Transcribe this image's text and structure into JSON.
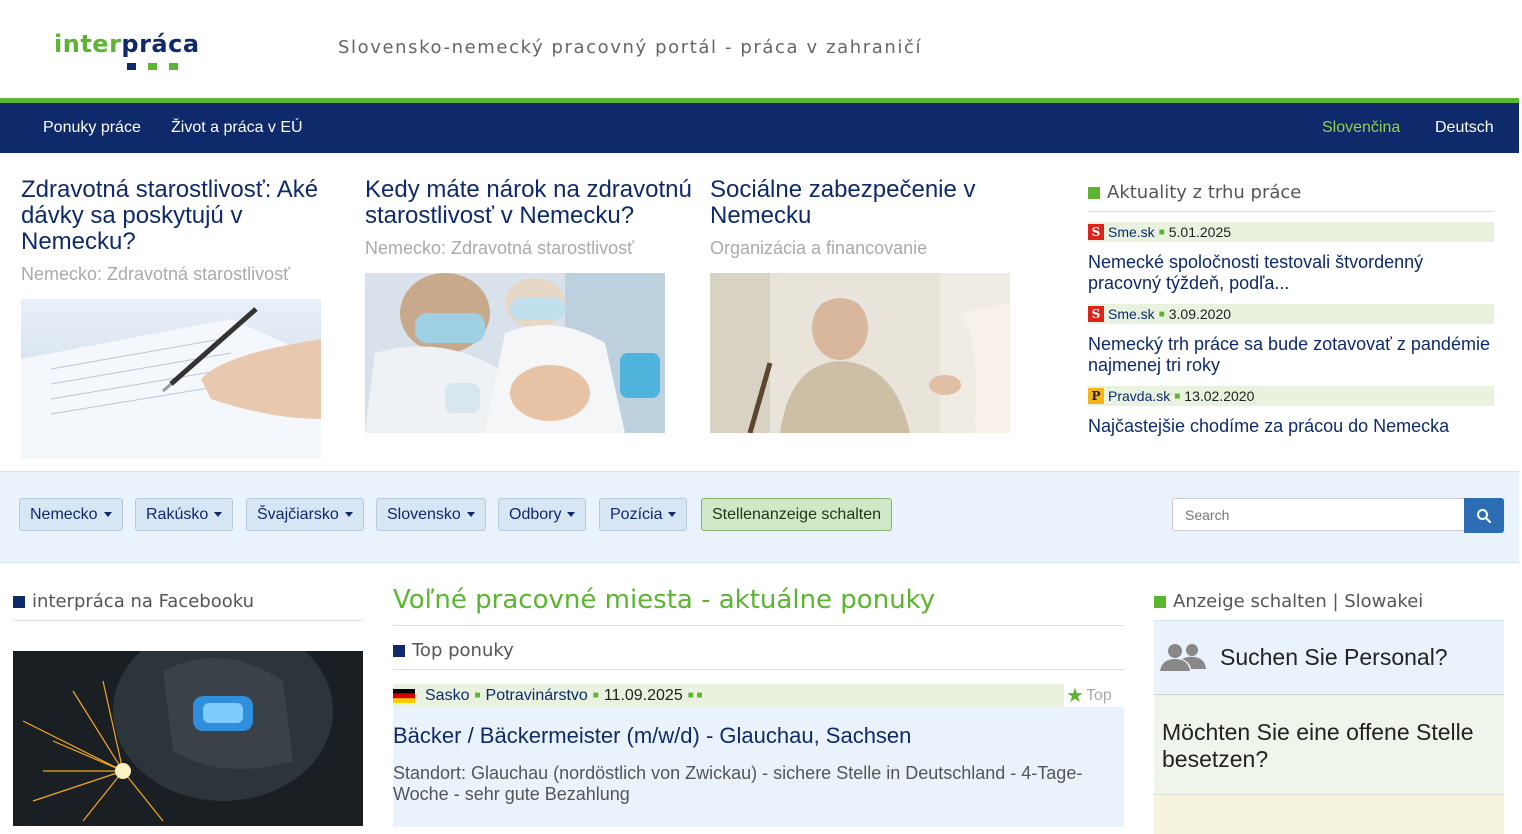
{
  "header": {
    "logo_part1": "inter",
    "logo_part2": "práca",
    "tagline": "Slovensko-nemecký pracovný portál - práca v zahraničí"
  },
  "nav": {
    "items": [
      "Ponuky práce",
      "Život a práca v EÚ"
    ],
    "lang_active": "Slovenčina",
    "lang_other": "Deutsch"
  },
  "articles": [
    {
      "title": "Zdravotná starostlivosť: Aké dávky sa poskytujú v Nemecku?",
      "sub": "Nemecko: Zdravotná starostlivosť"
    },
    {
      "title": "Kedy máte nárok na zdravotnú starostlivosť v Nemecku?",
      "sub": "Nemecko: Zdravotná starostlivosť"
    },
    {
      "title": "Sociálne zabezpečenie v Nemecku",
      "sub": "Organizácia a financovanie"
    }
  ],
  "news": {
    "title": "Aktuality z trhu práce",
    "items": [
      {
        "source": "Sme.sk",
        "icon": "S",
        "date": "5.01.2025",
        "title": "Nemecké spoločnosti testovali štvordenný pracovný týždeň, podľa..."
      },
      {
        "source": "Sme.sk",
        "icon": "S",
        "date": "3.09.2020",
        "title": "Nemecký trh práce sa bude zotavovať z pandémie najmenej tri roky"
      },
      {
        "source": "Pravda.sk",
        "icon": "P",
        "date": "13.02.2020",
        "title": "Najčastejšie chodíme za prácou do Nemecka"
      }
    ]
  },
  "filters": {
    "dropdowns": [
      "Nemecko",
      "Rakúsko",
      "Švajčiarsko",
      "Slovensko",
      "Odbory",
      "Pozícia"
    ],
    "action": "Stellenanzeige schalten",
    "search_placeholder": "Search"
  },
  "facebook": {
    "title": "interpráca na Facebooku"
  },
  "jobs": {
    "heading": "Voľné pracovné miesta - aktuálne ponuky",
    "top_title": "Top ponuky",
    "top_label": "Top",
    "first": {
      "region": "Sasko",
      "field": "Potravinárstvo",
      "date": "11.09.2025",
      "title": "Bäcker / Bäckermeister (m/w/d) - Glauchau, Sachsen",
      "desc": "Standort: Glauchau (nordöstlich von Zwickau) - sichere Stelle in Deutschland - 4-Tage-Woche - sehr gute Bezahlung"
    }
  },
  "ads": {
    "title": "Anzeige schalten | Slowakei",
    "promo1": "Suchen Sie Personal?",
    "promo2": "Möchten Sie eine offene Stelle besetzen?"
  },
  "colors": {
    "brand_green": "#5cb531",
    "brand_navy": "#0e2a6b",
    "filter_bg": "#eaf3fb",
    "search_blue": "#2d6db3"
  }
}
